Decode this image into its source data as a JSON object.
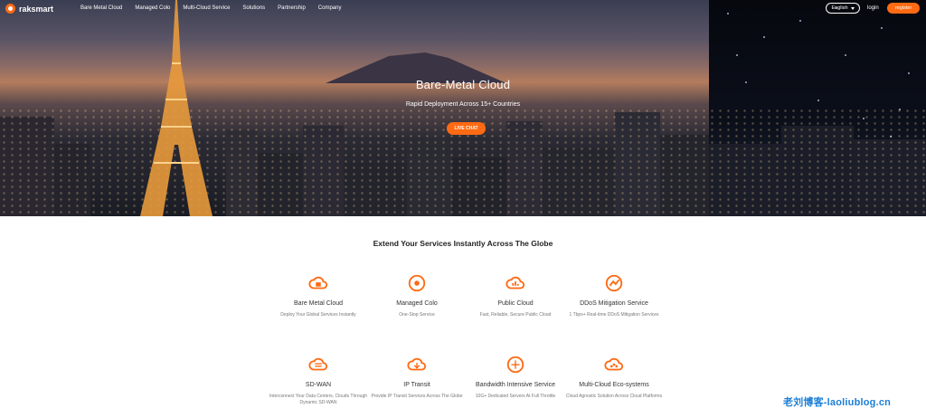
{
  "brand": {
    "name": "raksmart",
    "accent": "#ff6a13"
  },
  "nav": {
    "items": [
      "Bare Metal Cloud",
      "Managed Colo",
      "Multi-Cloud Service",
      "Solutions",
      "Partnership",
      "Company"
    ],
    "language": "English",
    "login": "login",
    "register": "register"
  },
  "hero": {
    "title": "Bare-Metal Cloud",
    "subtitle": "Rapid Deployment Across 15+ Countries",
    "cta": "LIVE CHAT"
  },
  "services": {
    "heading": "Extend Your Services Instantly Across The Globe",
    "items": [
      {
        "icon": "server-cloud-icon",
        "name": "Bare Metal Cloud",
        "desc": "Deploy Your Global Services Instantly"
      },
      {
        "icon": "colo-cloud-icon",
        "name": "Managed Colo",
        "desc": "One-Stop Service"
      },
      {
        "icon": "public-cloud-icon",
        "name": "Public Cloud",
        "desc": "Fast, Reliable, Secure Public Cloud"
      },
      {
        "icon": "ddos-shield-icon",
        "name": "DDoS Mitigation Service",
        "desc": "1 Tbps+ Real-time DDoS Mitigation Services"
      },
      {
        "icon": "sdwan-icon",
        "name": "SD-WAN",
        "desc": "Interconnect Your Data Centers, Clouds Through Dynamic SD-WAN"
      },
      {
        "icon": "ip-transit-icon",
        "name": "IP Transit",
        "desc": "Provide IP Transit Services Across The Globe"
      },
      {
        "icon": "bandwidth-icon",
        "name": "Bandwidth Intensive Service",
        "desc": "10G+ Dedicated Servers At Full Throttle"
      },
      {
        "icon": "multi-cloud-icon",
        "name": "Multi-Cloud Eco-systems",
        "desc": "Cloud Agnostic Solution Across Cloud Platforms"
      }
    ]
  },
  "watermark": "老刘博客-laoliublog.cn"
}
